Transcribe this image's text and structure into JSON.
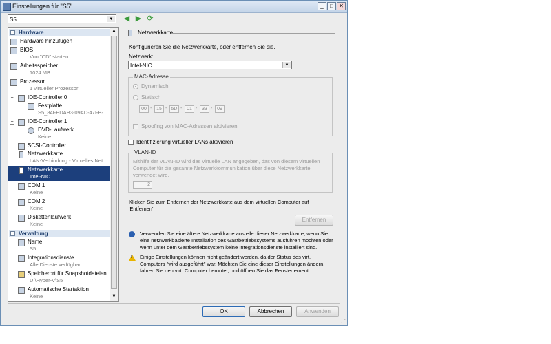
{
  "window": {
    "title": "Einstellungen für \"S5\"",
    "buttons": {
      "minimize": "_",
      "maximize": "□",
      "close": "✕"
    }
  },
  "vm_selector": {
    "value": "S5"
  },
  "tree": {
    "hardware_header": "Hardware",
    "items": [
      {
        "name": "Hardware hinzufügen",
        "sub": ""
      },
      {
        "name": "BIOS",
        "sub": "Von \"CD\" starten"
      },
      {
        "name": "Arbeitsspeicher",
        "sub": "1024 MB"
      },
      {
        "name": "Prozessor",
        "sub": "1 virtueller Prozessor"
      },
      {
        "name": "IDE-Controller 0",
        "sub": ""
      },
      {
        "name": "Festplatte",
        "sub": "S5_84FEDAB3-09AD-47FB-..."
      },
      {
        "name": "IDE-Controller 1",
        "sub": ""
      },
      {
        "name": "DVD-Laufwerk",
        "sub": "Keine"
      },
      {
        "name": "SCSI-Controller",
        "sub": ""
      },
      {
        "name": "Netzwerkkarte",
        "sub": "LAN-Verbindung - Virtuelles Net..."
      },
      {
        "name": "Netzwerkkarte",
        "sub": "Intel-NIC"
      },
      {
        "name": "COM 1",
        "sub": "Keine"
      },
      {
        "name": "COM 2",
        "sub": "Keine"
      },
      {
        "name": "Diskettenlaufwerk",
        "sub": "Keine"
      }
    ],
    "management_header": "Verwaltung",
    "mgmt_items": [
      {
        "name": "Name",
        "sub": "S5"
      },
      {
        "name": "Integrationsdienste",
        "sub": "Alle Dienste verfügbar"
      },
      {
        "name": "Speicherort für Snapshotdateien",
        "sub": "D:\\Hyper-V\\S5"
      },
      {
        "name": "Automatische Startaktion",
        "sub": "Keine"
      }
    ]
  },
  "panel": {
    "heading": "Netzwerkkarte",
    "intro": "Konfigurieren Sie die Netzwerkkarte, oder entfernen Sie sie.",
    "network_label": "Netzwerk:",
    "network_value": "Intel-NIC",
    "mac_group": "MAC-Adresse",
    "mac_dynamic": "Dynamisch",
    "mac_static": "Statisch",
    "mac_octets": [
      "00",
      "15",
      "5D",
      "01",
      "33",
      "09"
    ],
    "mac_spoofing": "Spoofing von MAC-Adressen aktivieren",
    "vlan_check": "Identifizierung virtueller LANs aktivieren",
    "vlan_group": "VLAN-ID",
    "vlan_text": "Mithilfe der VLAN-ID wird das virtuelle LAN angegeben, das von diesem virtuellen Computer für die gesamte Netzwerkkommunikation über diese Netzwerkkarte verwendet wird.",
    "vlan_value": "2",
    "remove_text": "Klicken Sie zum Entfernen der Netzwerkkarte aus dem virtuellen Computer auf 'Entfernen'.",
    "remove_button": "Entfernen",
    "info_text": "Verwenden Sie eine ältere Netzwerkkarte anstelle dieser Netzwerkkarte, wenn Sie eine netzwerkbasierte Installation des Gastbetriebssystems ausführen möchten oder wenn unter dem Gastbetriebssystem keine Integrationsdienste installiert sind.",
    "warn_text": "Einige Einstellungen können nicht geändert werden, da der Status des virt. Computers \"wird ausgeführt\" war. Möchten Sie eine dieser Einstellungen ändern, fahren Sie den virt. Computer herunter, und öffnen Sie das Fenster erneut."
  },
  "footer": {
    "ok": "OK",
    "cancel": "Abbrechen",
    "apply": "Anwenden"
  }
}
